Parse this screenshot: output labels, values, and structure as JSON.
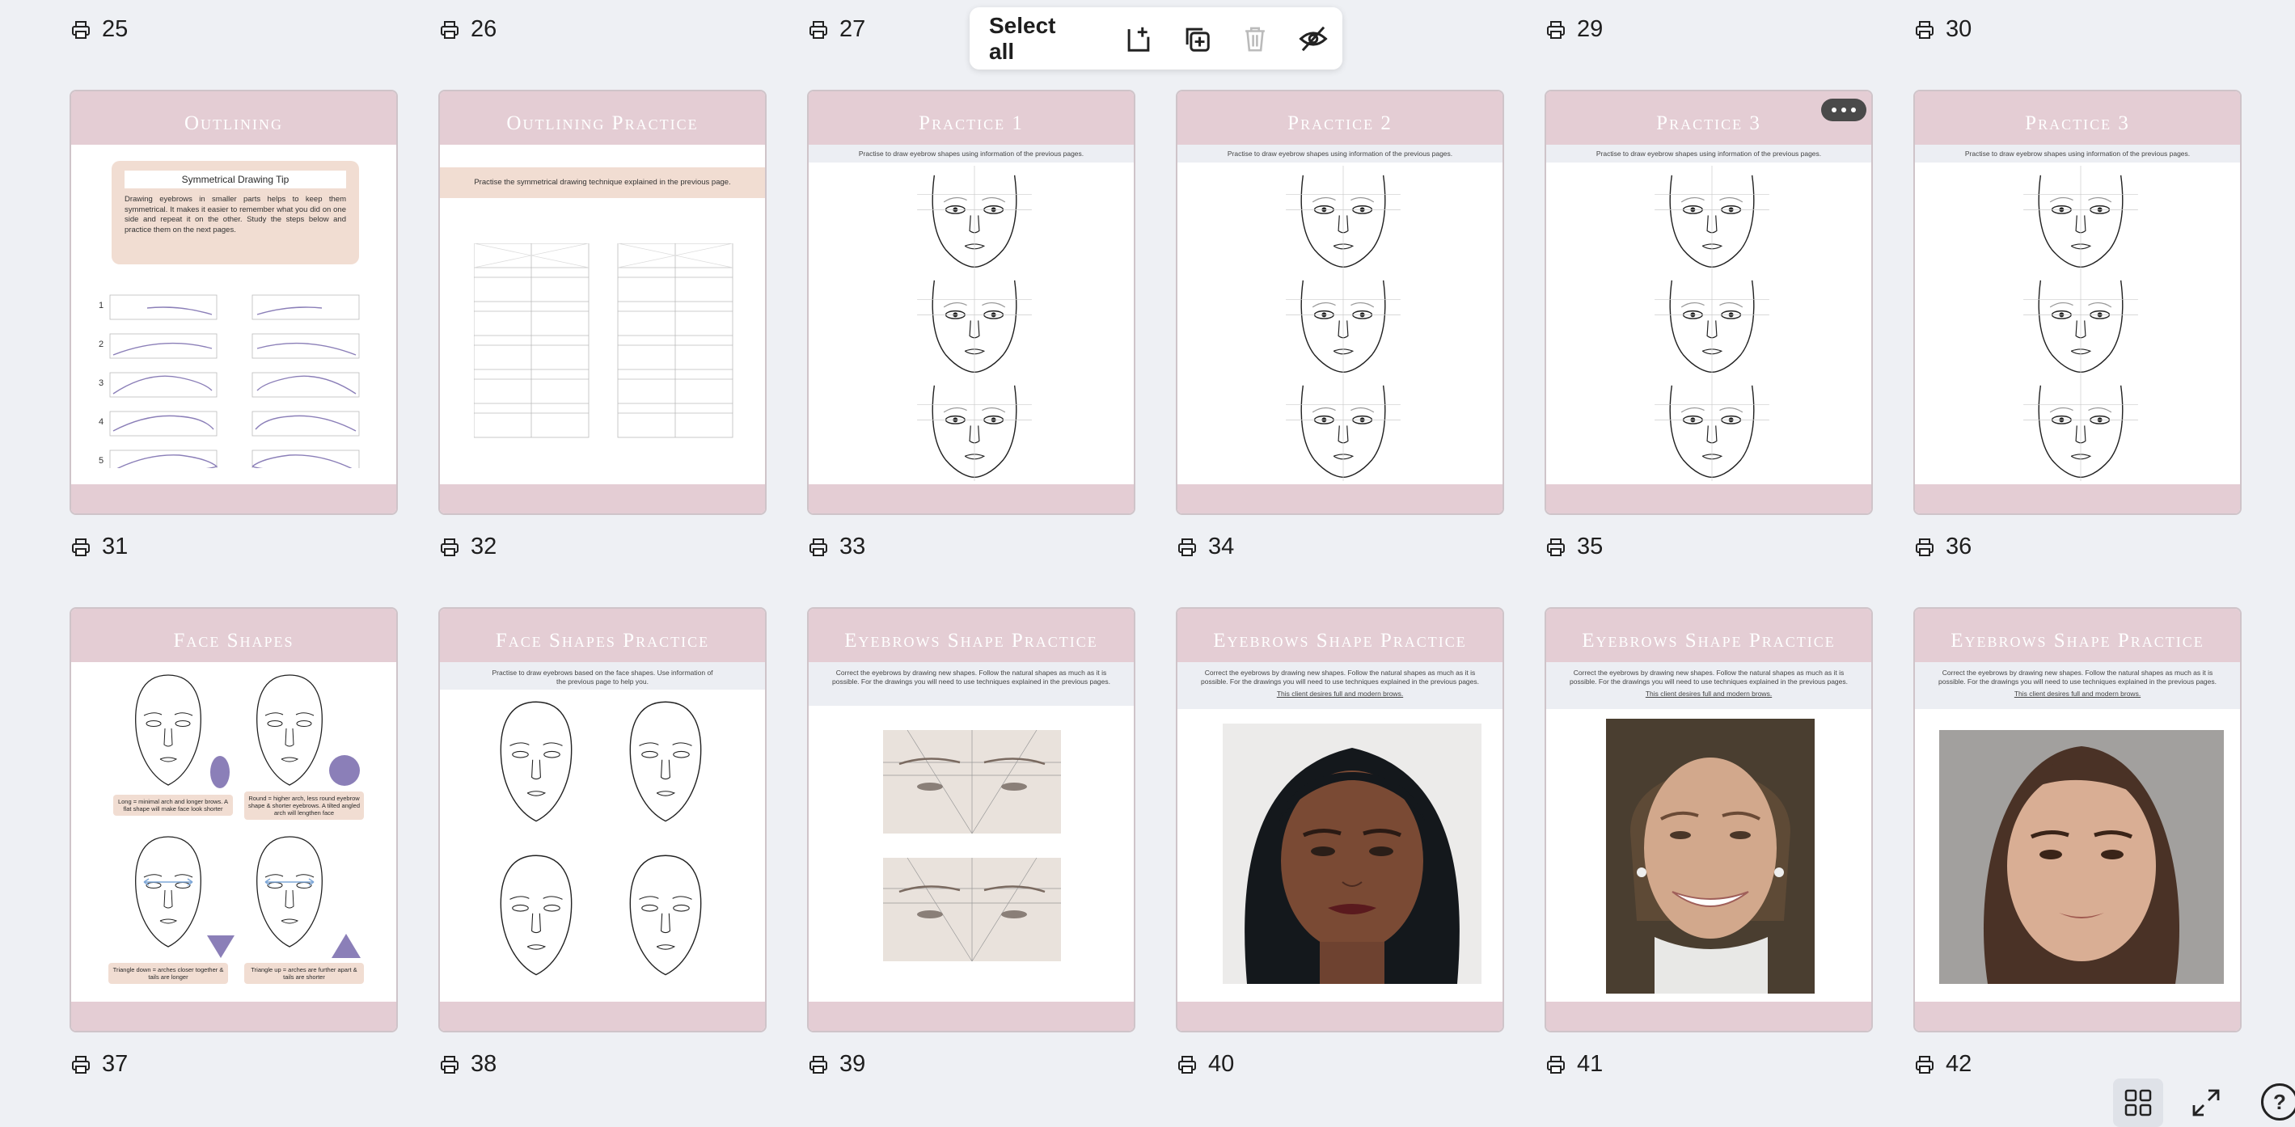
{
  "toolbar": {
    "select_all": "Select all",
    "icons": [
      "add-page-icon",
      "duplicate-icon",
      "trash-icon",
      "hide-icon"
    ]
  },
  "top_numbers": [
    "25",
    "26",
    "27",
    "29",
    "30"
  ],
  "row1": [
    {
      "number": "31",
      "title": "Outlining",
      "tip_title": "Symmetrical Drawing Tip",
      "tip_body": "Drawing eyebrows in smaller parts helps to keep them symmetrical. It makes it easier to remember what you did on one side and repeat it on the other. Study the steps below and practice them on the next pages.",
      "steps": [
        "1",
        "2",
        "3",
        "4",
        "5"
      ]
    },
    {
      "number": "32",
      "title": "Outlining Practice",
      "instruction": "Practise the symmetrical drawing technique explained in the previous page."
    },
    {
      "number": "33",
      "title": "Practice 1",
      "instruction": "Practise to draw eyebrow shapes using information of the previous pages."
    },
    {
      "number": "34",
      "title": "Practice 2",
      "instruction": "Practise to draw eyebrow shapes using information of the previous pages."
    },
    {
      "number": "35",
      "title": "Practice 3",
      "instruction": "Practise to draw eyebrow shapes using information of the previous pages."
    },
    {
      "number": "36",
      "title": "Practice 3",
      "instruction": "Practise to draw eyebrow shapes using information of the previous pages."
    }
  ],
  "row2": [
    {
      "number": "37",
      "title": "Face Shapes",
      "labels": [
        "Long = minimal arch and longer brows. A flat shape will make face look shorter",
        "Round = higher arch, less round eyebrow shape & shorter eyebrows. A tilted angled arch will lengthen face",
        "Triangle down = arches closer together & tails are longer",
        "Triangle up = arches are further apart & tails are shorter"
      ]
    },
    {
      "number": "38",
      "title": "Face Shapes Practice",
      "instruction": "Practise to draw eyebrows based on the face shapes. Use information of the previous page to help you."
    },
    {
      "number": "39",
      "title": "Eyebrows Shape Practice",
      "instruction": "Correct the eyebrows by drawing new shapes. Follow the natural shapes as much as it is possible. For the drawings you will need to use techniques explained in the previous pages."
    },
    {
      "number": "40",
      "title": "Eyebrows Shape Practice",
      "instruction": "Correct the eyebrows by drawing new shapes. Follow the natural shapes as much as it is possible. For the drawings you will need to use techniques explained in the previous pages.",
      "note": "This client desires full and modern brows."
    },
    {
      "number": "41",
      "title": "Eyebrows Shape Practice",
      "instruction": "Correct the eyebrows by drawing new shapes. Follow the natural shapes as much as it is possible. For the drawings you will need to use techniques explained in the previous pages.",
      "note": "This client desires full and modern brows."
    },
    {
      "number": "42",
      "title": "Eyebrows Shape Practice",
      "instruction": "Correct the eyebrows by drawing new shapes. Follow the natural shapes as much as it is possible. For the drawings you will need to use techniques explained in the previous pages.",
      "note": "This client desires full and modern brows."
    }
  ],
  "colors": {
    "header": "#e4cdd4",
    "tip_box": "#f1ddd2",
    "accent": "#8b7fb8"
  },
  "bottom_icons": [
    "grid-view-icon",
    "fullscreen-icon",
    "help-icon"
  ],
  "help_label": "?"
}
